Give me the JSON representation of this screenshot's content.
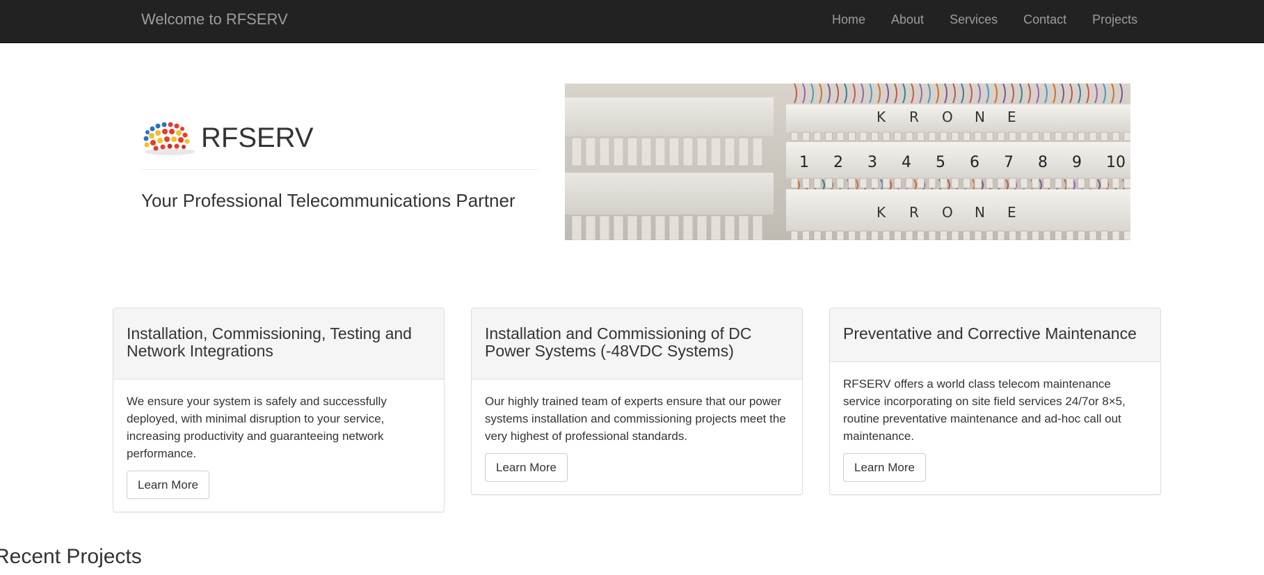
{
  "navbar": {
    "brand": "Welcome to RFSERV",
    "items": [
      {
        "label": "Home"
      },
      {
        "label": "About"
      },
      {
        "label": "Services"
      },
      {
        "label": "Contact"
      },
      {
        "label": "Projects"
      }
    ]
  },
  "hero": {
    "logo_text": "RFSERV",
    "tagline": "Your Professional Telecommunications Partner",
    "image": {
      "row_labels": [
        "K",
        "R",
        "O",
        "N",
        "E"
      ],
      "numbers": [
        "1",
        "2",
        "3",
        "4",
        "5",
        "6",
        "7",
        "8",
        "9",
        "10"
      ]
    }
  },
  "services": [
    {
      "title": "Installation, Commissioning, Testing and Network Integrations",
      "text": "We ensure your system is safely and successfully deployed, with minimal disruption to your service, increasing productivity and guaranteeing network performance.",
      "button": "Learn More"
    },
    {
      "title": "Installation and Commissioning of DC Power Systems (-48VDC Systems)",
      "text": "Our highly trained team of experts ensure that our power systems installation and commissioning projects meet the very highest of professional standards.",
      "button": "Learn More"
    },
    {
      "title": "Preventative and Corrective Maintenance",
      "text": "RFSERV offers a world class telecom maintenance service incorporating on site field services 24/7or 8×5, routine preventative maintenance and ad-hoc call out maintenance.",
      "button": "Learn More"
    }
  ],
  "recent_projects": {
    "heading": "Recent Projects"
  },
  "colors": {
    "navbar_bg": "#222222",
    "nav_text": "#9d9d9d",
    "panel_heading_bg": "#f5f5f5",
    "border": "#dddddd",
    "text": "#333333"
  }
}
